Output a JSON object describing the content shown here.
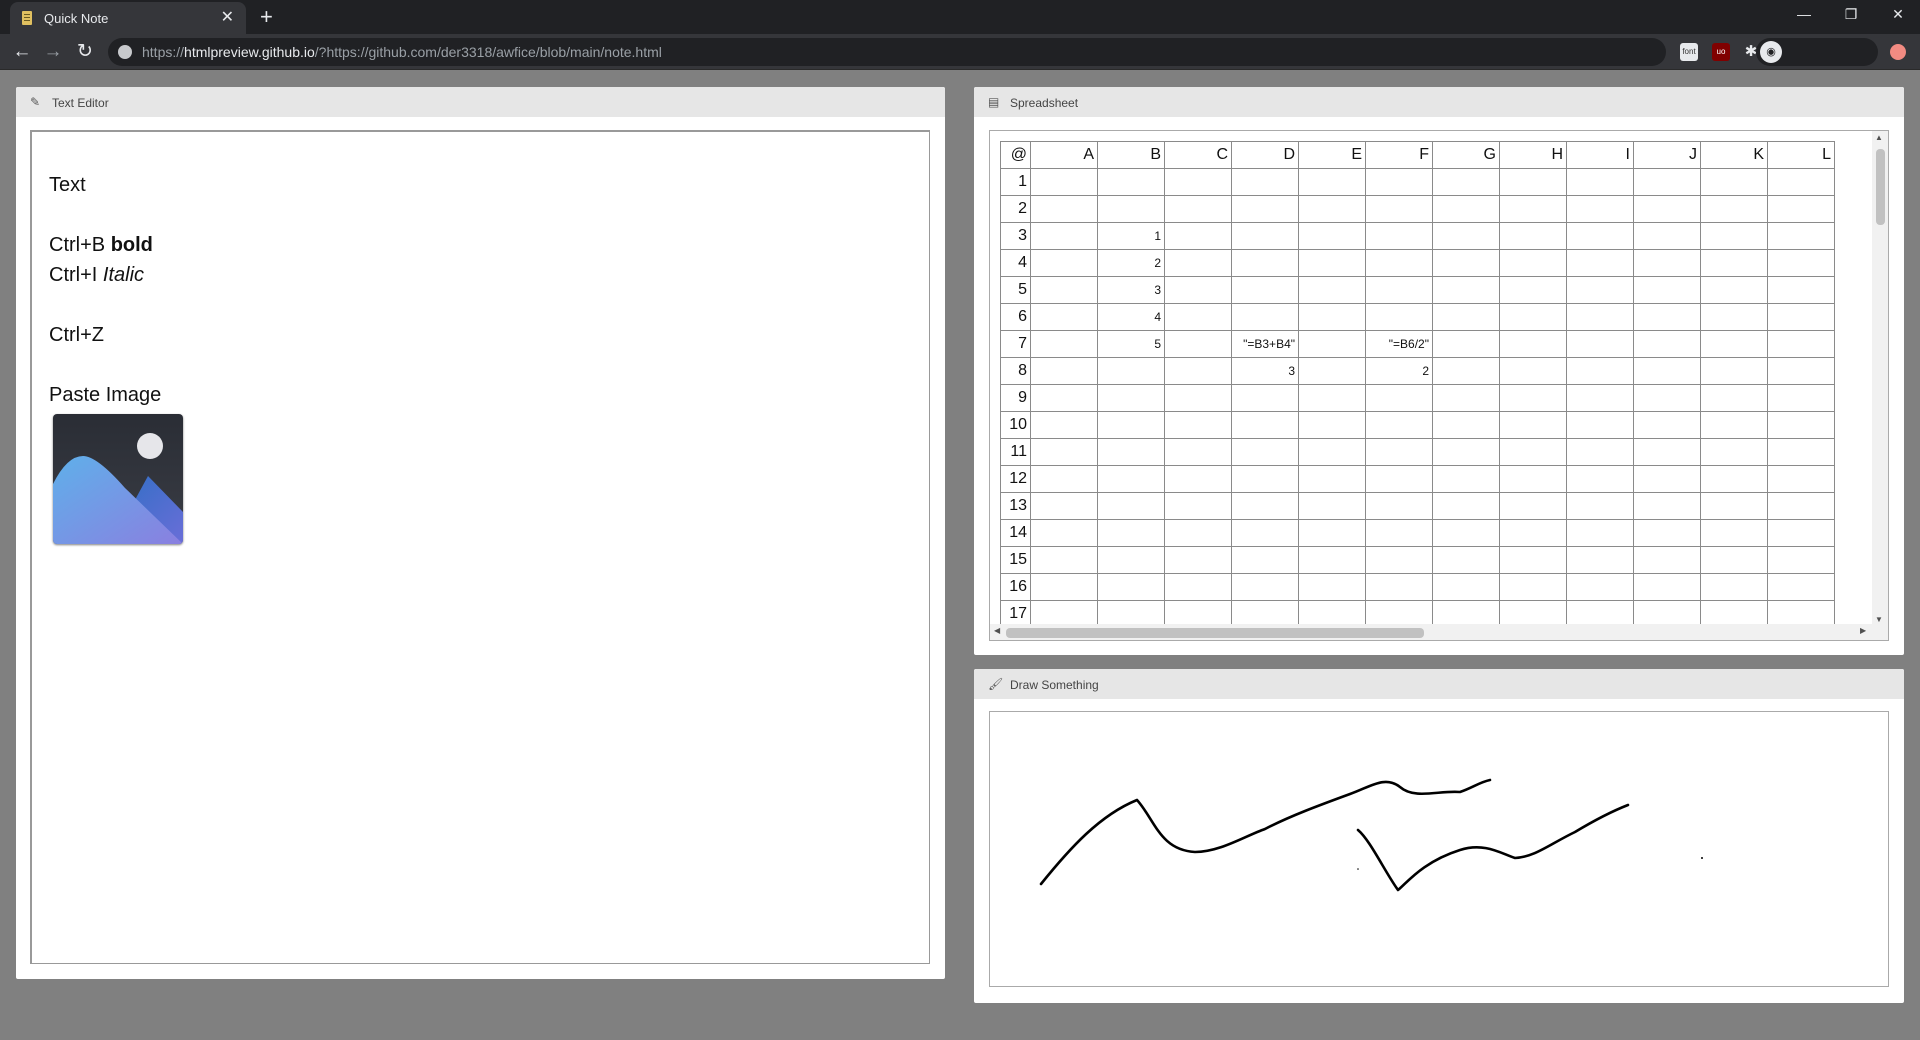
{
  "browser": {
    "tab_title": "Quick Note",
    "tab_close": "✕",
    "new_tab": "+",
    "url_scheme": "https://",
    "url_host": "htmlpreview.github.io",
    "url_rest": "/?https://github.com/der3318/awfice/blob/main/note.html",
    "ext_font_label": "font",
    "ext_ublock_label": "uo"
  },
  "editor": {
    "title": "Text Editor",
    "icon": "pencil-icon",
    "lines": {
      "l1": "Text",
      "l2_prefix": "Ctrl+B ",
      "l2_bold": "bold",
      "l3_prefix": "Ctrl+I ",
      "l3_italic": "Italic",
      "l4": "Ctrl+Z",
      "l5": "Paste Image"
    }
  },
  "spreadsheet": {
    "title": "Spreadsheet",
    "icon": "table-icon",
    "corner": "@",
    "columns": [
      "A",
      "B",
      "C",
      "D",
      "E",
      "F",
      "G",
      "H",
      "I",
      "J",
      "K",
      "L"
    ],
    "rows": [
      "1",
      "2",
      "3",
      "4",
      "5",
      "6",
      "7",
      "8",
      "9",
      "10",
      "11",
      "12",
      "13",
      "14",
      "15",
      "16",
      "17"
    ],
    "cells": {
      "B3": "1",
      "B4": "2",
      "B5": "3",
      "B6": "4",
      "B7": "5",
      "D7": "\"=B3+B4\"",
      "F7": "\"=B6/2\"",
      "D8": "3",
      "F8": "2"
    }
  },
  "draw": {
    "title": "Draw Something",
    "icon": "brush-icon"
  },
  "colors": {
    "page_bg": "#808080",
    "panel_header": "#e6e6e6",
    "chrome_dark": "#202124",
    "chrome_tab": "#35363a"
  }
}
